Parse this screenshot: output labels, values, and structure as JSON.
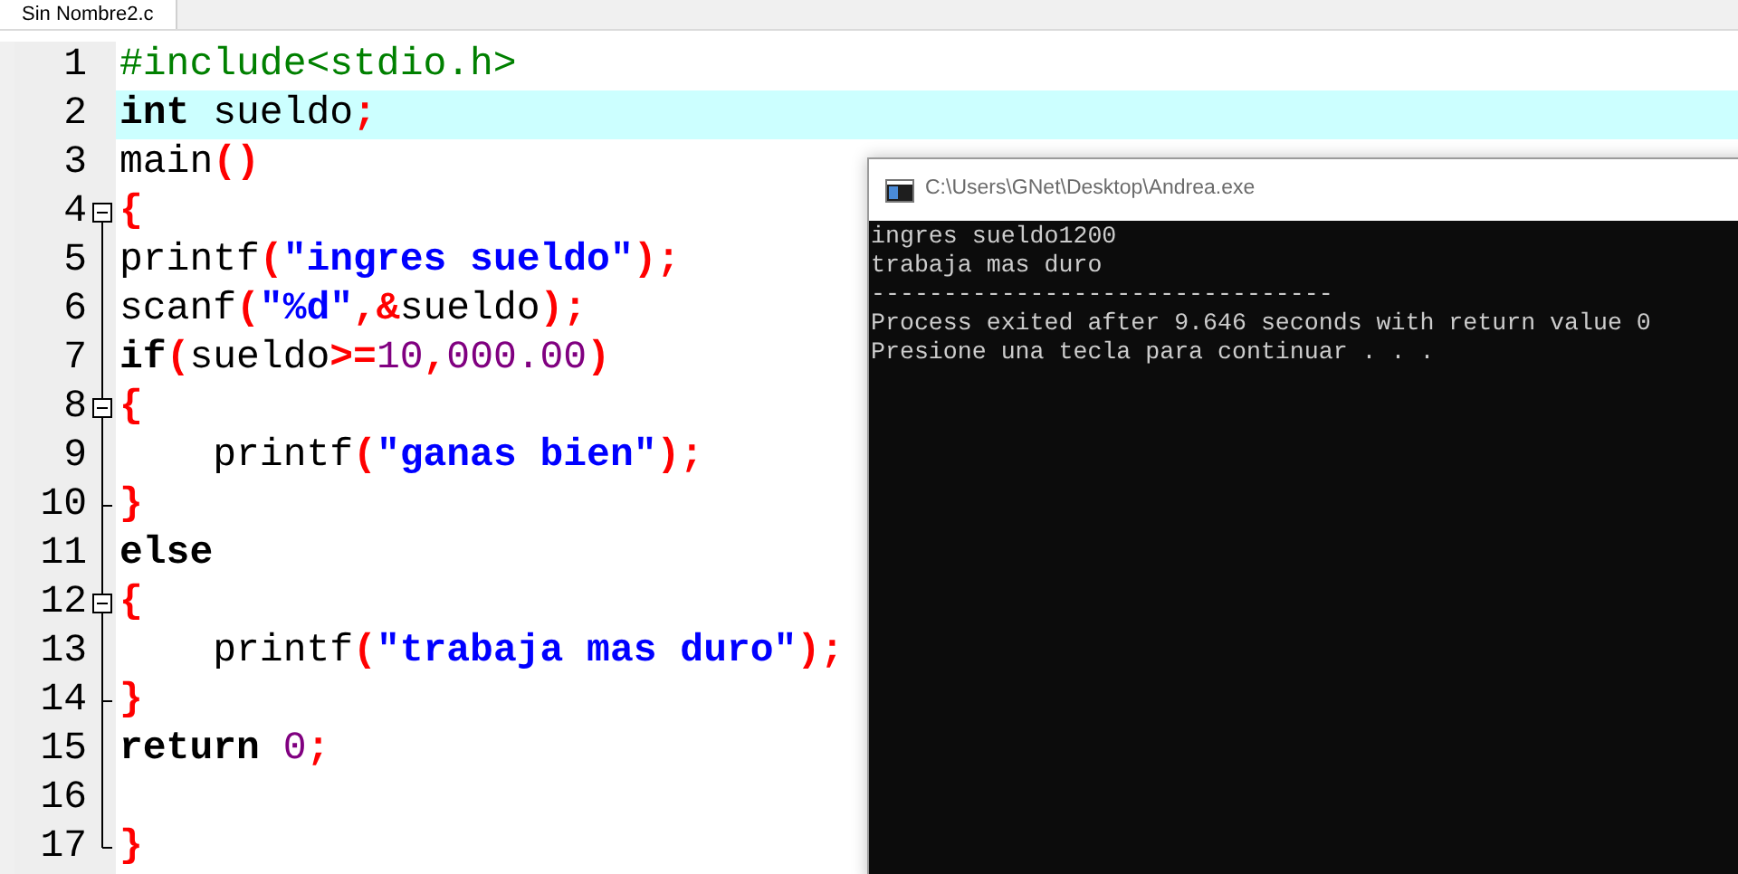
{
  "tabs": [
    {
      "label": "Sin Nombre2.c",
      "selected": true
    }
  ],
  "editor": {
    "lines": [
      {
        "number": "1",
        "highlighted": false,
        "kind": "plain",
        "tokens": [
          {
            "text": "#include<stdio.h>",
            "kind": "preproc"
          }
        ]
      },
      {
        "number": "2",
        "highlighted": true,
        "kind": "plain",
        "tokens": [
          {
            "text": "int",
            "kind": "keyword"
          },
          {
            "text": " sueldo",
            "kind": "ident"
          },
          {
            "text": ";",
            "kind": "symbol"
          }
        ]
      },
      {
        "number": "3",
        "highlighted": false,
        "kind": "plain",
        "tokens": [
          {
            "text": "main",
            "kind": "ident"
          },
          {
            "text": "()",
            "kind": "symbol"
          }
        ]
      },
      {
        "number": "4",
        "highlighted": false,
        "kind": "open",
        "tokens": [
          {
            "text": "{",
            "kind": "symbol"
          }
        ]
      },
      {
        "number": "5",
        "highlighted": false,
        "kind": "plain",
        "tokens": [
          {
            "text": "printf",
            "kind": "ident"
          },
          {
            "text": "(",
            "kind": "symbol"
          },
          {
            "text": "\"ingres sueldo\"",
            "kind": "string"
          },
          {
            "text": ");",
            "kind": "symbol"
          }
        ]
      },
      {
        "number": "6",
        "highlighted": false,
        "kind": "plain",
        "tokens": [
          {
            "text": "scanf",
            "kind": "ident"
          },
          {
            "text": "(",
            "kind": "symbol"
          },
          {
            "text": "\"%d\"",
            "kind": "string"
          },
          {
            "text": ",&",
            "kind": "symbol"
          },
          {
            "text": "sueldo",
            "kind": "ident"
          },
          {
            "text": ");",
            "kind": "symbol"
          }
        ]
      },
      {
        "number": "7",
        "highlighted": false,
        "kind": "plain",
        "tokens": [
          {
            "text": "if",
            "kind": "keyword"
          },
          {
            "text": "(",
            "kind": "symbol"
          },
          {
            "text": "sueldo",
            "kind": "ident"
          },
          {
            "text": ">=",
            "kind": "symbol"
          },
          {
            "text": "10",
            "kind": "number"
          },
          {
            "text": ",",
            "kind": "symbol"
          },
          {
            "text": "000.00",
            "kind": "number"
          },
          {
            "text": ")",
            "kind": "symbol"
          }
        ]
      },
      {
        "number": "8",
        "highlighted": false,
        "kind": "open",
        "tokens": [
          {
            "text": "{",
            "kind": "symbol"
          }
        ]
      },
      {
        "number": "9",
        "highlighted": false,
        "kind": "plain",
        "tokens": [
          {
            "text": "    printf",
            "kind": "ident"
          },
          {
            "text": "(",
            "kind": "symbol"
          },
          {
            "text": "\"ganas bien\"",
            "kind": "string"
          },
          {
            "text": ");",
            "kind": "symbol"
          }
        ]
      },
      {
        "number": "10",
        "highlighted": false,
        "kind": "close",
        "tokens": [
          {
            "text": "}",
            "kind": "symbol"
          }
        ]
      },
      {
        "number": "11",
        "highlighted": false,
        "kind": "plain",
        "tokens": [
          {
            "text": "else",
            "kind": "keyword"
          }
        ]
      },
      {
        "number": "12",
        "highlighted": false,
        "kind": "open",
        "tokens": [
          {
            "text": "{",
            "kind": "symbol"
          }
        ]
      },
      {
        "number": "13",
        "highlighted": false,
        "kind": "plain",
        "tokens": [
          {
            "text": "    printf",
            "kind": "ident"
          },
          {
            "text": "(",
            "kind": "symbol"
          },
          {
            "text": "\"trabaja mas duro\"",
            "kind": "string"
          },
          {
            "text": ");",
            "kind": "symbol"
          }
        ]
      },
      {
        "number": "14",
        "highlighted": false,
        "kind": "close",
        "tokens": [
          {
            "text": "}",
            "kind": "symbol"
          }
        ]
      },
      {
        "number": "15",
        "highlighted": false,
        "kind": "plain",
        "tokens": [
          {
            "text": "return",
            "kind": "keyword"
          },
          {
            "text": " 0",
            "kind": "number"
          },
          {
            "text": ";",
            "kind": "symbol"
          }
        ]
      },
      {
        "number": "16",
        "highlighted": false,
        "kind": "plain"
      },
      {
        "number": "17",
        "highlighted": false,
        "kind": "last",
        "tokens": [
          {
            "text": "}",
            "kind": "symbol"
          }
        ]
      }
    ]
  },
  "console": {
    "title": "C:\\Users\\GNet\\Desktop\\Andrea.exe",
    "lines": [
      "ingres sueldo1200",
      "trabaja mas duro",
      "--------------------------------",
      "Process exited after 9.646 seconds with return value 0",
      "Presione una tecla para continuar . . ."
    ]
  }
}
